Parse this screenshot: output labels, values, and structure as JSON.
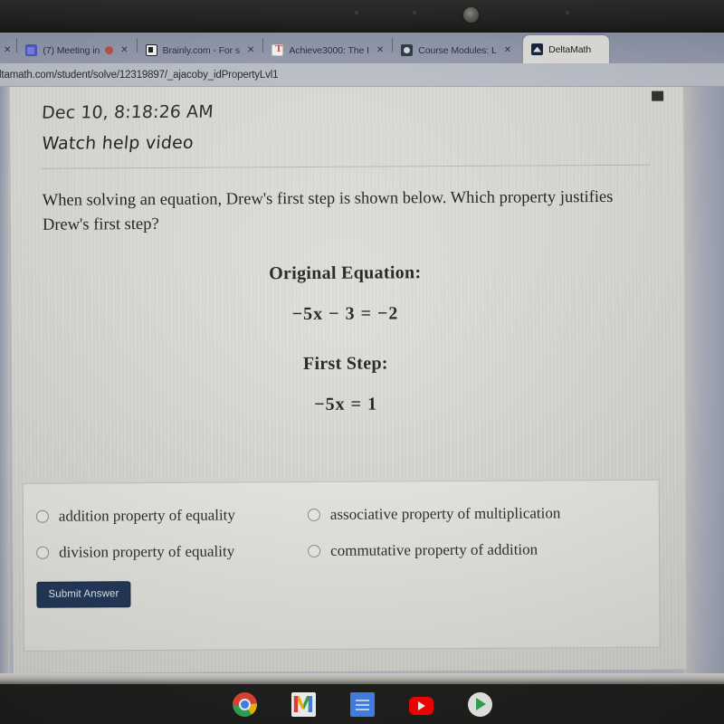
{
  "browser": {
    "url": "ltamath.com/student/solve/12319897/_ajacoby_idPropertyLvl1",
    "close_glyph": "✕",
    "tabs": [
      {
        "title": "",
        "icon": "generic-favicon",
        "close": "✕",
        "active": false
      },
      {
        "title": "(7) Meeting in",
        "icon": "microsoft-teams-icon",
        "close": "✕",
        "active": false
      },
      {
        "title": "Brainly.com - For s",
        "icon": "brainly-icon",
        "close": "✕",
        "active": false
      },
      {
        "title": "Achieve3000: The I",
        "icon": "achieve3000-icon",
        "close": "✕",
        "active": false
      },
      {
        "title": "Course Modules: L",
        "icon": "canvas-icon",
        "close": "✕",
        "active": false
      },
      {
        "title": "DeltaMath",
        "icon": "deltamath-icon",
        "close": "",
        "active": true
      }
    ]
  },
  "problem": {
    "timestamp": "Dec 10, 8:18:26 AM",
    "help_link": "Watch help video",
    "question": "When solving an equation, Drew's first step is shown below. Which property justifies Drew's first step?",
    "original_label": "Original Equation:",
    "original_equation": "−5x − 3 = −2",
    "first_step_label": "First Step:",
    "first_step_equation": "−5x = 1"
  },
  "answers": {
    "options": [
      {
        "label": "addition property of equality",
        "selected": false
      },
      {
        "label": "associative property of multiplication",
        "selected": false
      },
      {
        "label": "division property of equality",
        "selected": false
      },
      {
        "label": "commutative property of addition",
        "selected": false
      }
    ],
    "submit_label": "Submit Answer"
  },
  "taskbar": {
    "icons": [
      {
        "name": "chrome-icon"
      },
      {
        "name": "gmail-icon"
      },
      {
        "name": "google-docs-icon"
      },
      {
        "name": "youtube-icon"
      },
      {
        "name": "google-play-icon"
      }
    ]
  },
  "colors": {
    "submit_bg": "#1f3557",
    "tab_strip": "#9aa1b4",
    "card_bg": "#e2e0da"
  }
}
